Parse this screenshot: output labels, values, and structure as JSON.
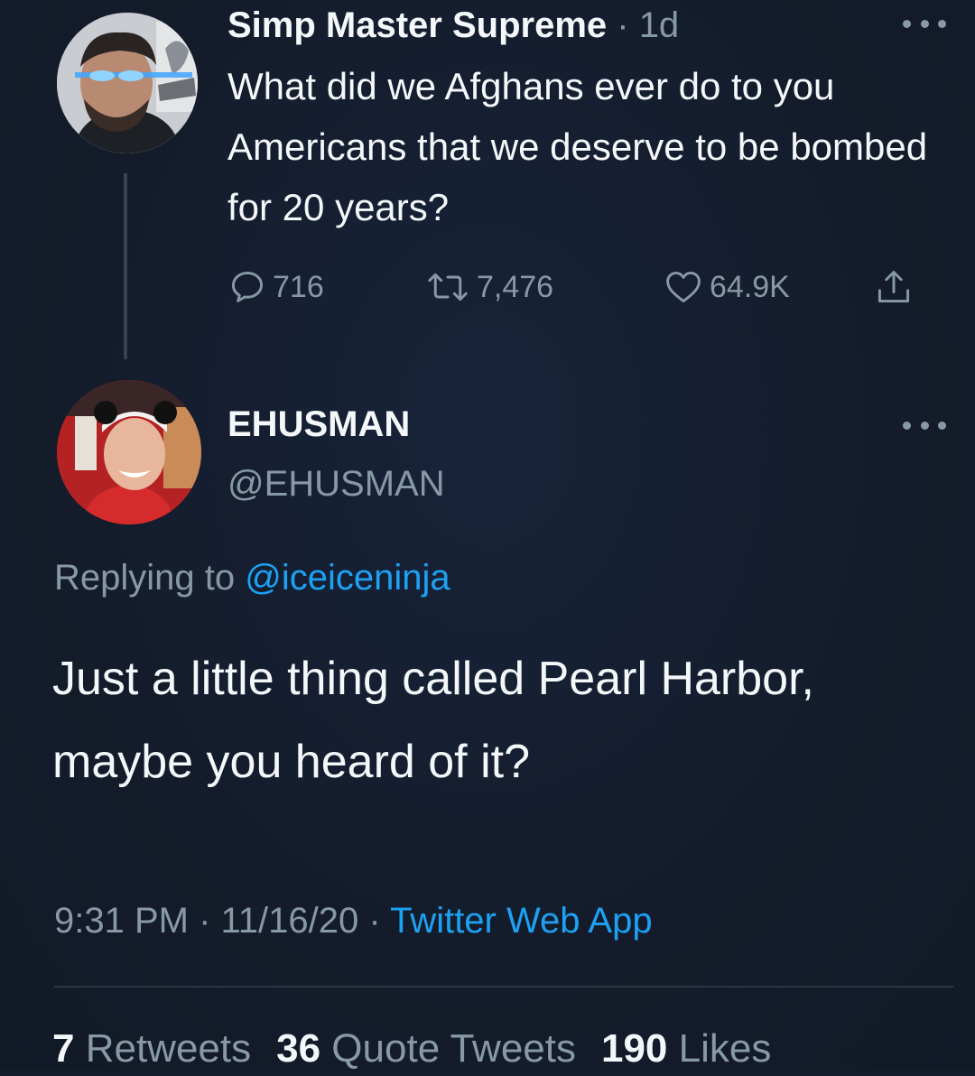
{
  "parent_tweet": {
    "display_name": "Simp Master Supreme",
    "separator": " · ",
    "time": "1d",
    "text": "What did we Afghans ever do to you Americans that we deserve to be bombed for 20 years?",
    "actions": {
      "replies": "716",
      "retweets": "7,476",
      "likes": "64.9K"
    },
    "icons": [
      "reply-icon",
      "retweet-icon",
      "heart-icon",
      "share-icon",
      "more-icon"
    ]
  },
  "reply_tweet": {
    "display_name": "EHUSMAN",
    "handle": "@EHUSMAN",
    "replying_prefix": "Replying to ",
    "replying_to": "@iceiceninja",
    "text": "Just a little thing called Pearl Harbor, maybe you heard of it?",
    "timestamp": "9:31 PM · 11/16/20 · ",
    "source": "Twitter Web App",
    "stats": {
      "retweets_count": "7",
      "retweets_label": " Retweets",
      "quote_count": "36",
      "quote_label": " Quote Tweets",
      "likes_count": "190",
      "likes_label": " Likes"
    }
  },
  "colors": {
    "background": "#141d2b",
    "text_primary": "#f5f8fa",
    "text_secondary": "#8899a6",
    "link": "#1da1f2",
    "thread_line": "#38444d"
  }
}
